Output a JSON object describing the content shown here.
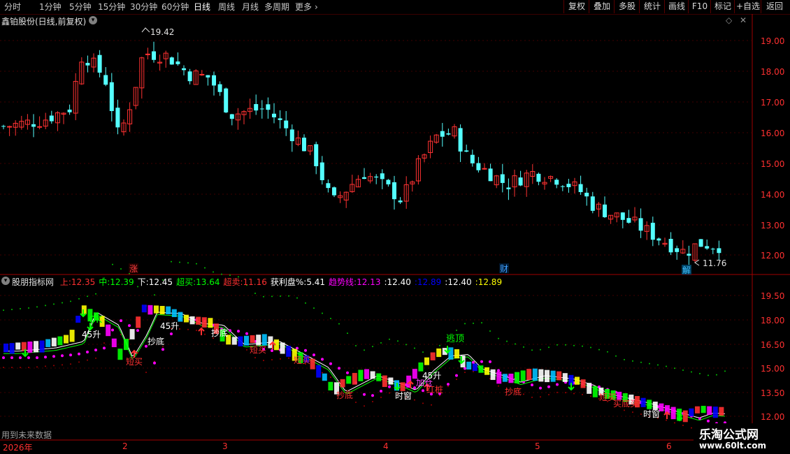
{
  "toolbar": {
    "periods": [
      "分时",
      "1分钟",
      "5分钟",
      "15分钟",
      "30分钟",
      "60分钟",
      "日线",
      "周线",
      "月线",
      "多周期",
      "更多"
    ],
    "active_period": "日线",
    "more_arrow": "›",
    "buttons": [
      "复权",
      "叠加",
      "多股",
      "统计",
      "画线",
      "F10",
      "标记",
      "+自选",
      "返回"
    ]
  },
  "chart_header": {
    "stock_title": "鑫铂股份(日线,前复权)",
    "diamond": "◇",
    "close_x": "✕"
  },
  "price_axis": {
    "ticks": [
      "19.00",
      "18.00",
      "17.00",
      "16.00",
      "15.00",
      "14.00",
      "13.00",
      "12.00"
    ]
  },
  "indicator_axis": {
    "ticks": [
      "19.50",
      "18.00",
      "16.50",
      "15.00",
      "13.50",
      "12.00"
    ]
  },
  "annotations": {
    "high": "19.42",
    "low": "11.76"
  },
  "markers": [
    {
      "text": "涨",
      "color": "#ff4040"
    },
    {
      "text": "财",
      "color": "#40a0ff"
    },
    {
      "text": "解",
      "color": "#40c0ff"
    }
  ],
  "indicator_header": {
    "name": "股朋指标网",
    "items": [
      {
        "label": "上:",
        "value": "12.35",
        "color": "#ff3030"
      },
      {
        "label": "中:",
        "value": "12.39",
        "color": "#00ff00"
      },
      {
        "label": "下:",
        "value": "12.45",
        "color": "#ffffff"
      },
      {
        "label": "超买:",
        "value": "13.64",
        "color": "#00ff00"
      },
      {
        "label": "超卖:",
        "value": "11.16",
        "color": "#ff3030"
      },
      {
        "label": "获利盘%:",
        "value": "5.41",
        "color": "#ffffff"
      },
      {
        "label": "趋势线:",
        "value": "12.13",
        "color": "#ff00ff"
      },
      {
        "label": ":",
        "value": "12.40",
        "color": "#ffffff"
      },
      {
        "label": ":",
        "value": "12.89",
        "color": "#0000ff"
      },
      {
        "label": ":",
        "value": "12.40",
        "color": "#ffffff"
      },
      {
        "label": ":",
        "value": "12.89",
        "color": "#ffff00"
      }
    ]
  },
  "signals": {
    "ok": "OK",
    "rise45": "45升",
    "buy_short": "短买",
    "escape_top": "逃顶",
    "bottom": "抄底",
    "time_window": "时窗",
    "add": "加仓",
    "up_pile": "红桩",
    "buy_bottom": "买底买"
  },
  "footer": {
    "future_note": "用到未来数据",
    "time_labels": [
      "2026年",
      "2",
      "3",
      "4",
      "5",
      "6"
    ]
  },
  "watermark": {
    "name": "乐淘公式网",
    "url": "www.60lt.com"
  },
  "colors": {
    "up": "#ff3232",
    "down": "#54ffff",
    "axis": "#a00000",
    "accent": "#ff00ff"
  }
}
